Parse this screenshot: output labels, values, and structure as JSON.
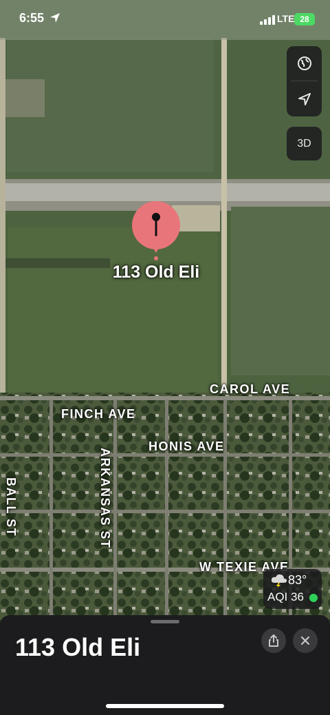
{
  "status_bar": {
    "time": "6:55",
    "network": "LTE",
    "battery": "28"
  },
  "map_controls": {
    "globe_icon": "globe-icon",
    "location_icon": "location-arrow-icon",
    "view_3d_label": "3D"
  },
  "pin": {
    "label": "113 Old Eli",
    "color": "#e8757a"
  },
  "streets": {
    "carol": "CAROL AVE",
    "finch": "FINCH AVE",
    "honis": "HONIS AVE",
    "ball": "BALL ST",
    "arkansas": "ARKANSAS ST",
    "texie": "W TEXIE AVE"
  },
  "weather": {
    "temperature": "83°",
    "aqi": "AQI 36",
    "icon": "thunderstorm-cloud-icon",
    "aqi_color": "#30d158"
  },
  "place_sheet": {
    "title": "113 Old Eli",
    "share_icon": "share-icon",
    "close_icon": "close-icon"
  }
}
